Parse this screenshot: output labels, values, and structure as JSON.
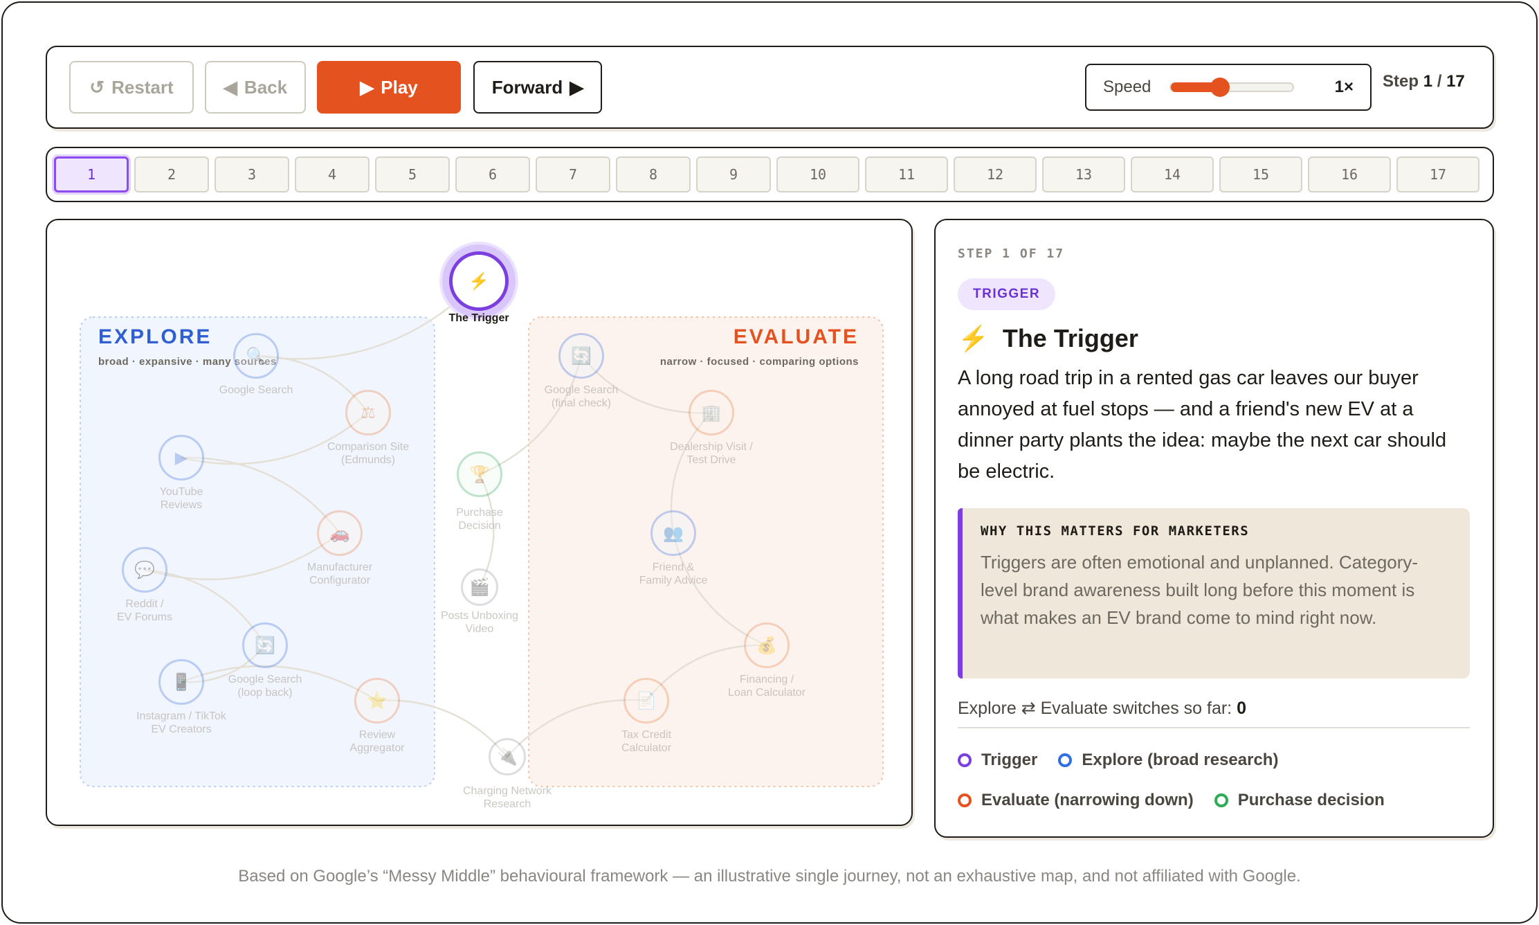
{
  "controls": {
    "restart_label": "Restart",
    "back_label": "Back",
    "play_label": "Play",
    "forward_label": "Forward",
    "speed_label": "Speed",
    "speed_value": "1×",
    "speed_level": 0.35,
    "step_prefix": "Step",
    "step_current": "1",
    "step_sep": "/",
    "step_total": "17",
    "colors": {
      "play": "#e4531f",
      "active": "#8b4cf0"
    }
  },
  "steps": [
    "1",
    "2",
    "3",
    "4",
    "5",
    "6",
    "7",
    "8",
    "9",
    "10",
    "11",
    "12",
    "13",
    "14",
    "15",
    "16",
    "17"
  ],
  "active_step": 1,
  "map": {
    "explore": {
      "title": "EXPLORE",
      "subtitle": "broad · expansive · many sources",
      "color": "#2f5fd0"
    },
    "evaluate": {
      "title": "EVALUATE",
      "subtitle": "narrow · focused · comparing options",
      "color": "#e4531f"
    },
    "nodes": [
      {
        "kind": "trigger",
        "icon": "⚡",
        "icon_name": "lightning-icon",
        "label": [
          "The Trigger"
        ]
      },
      {
        "kind": "explore",
        "icon": "🔍",
        "icon_name": "search-icon",
        "label": [
          "Google Search"
        ]
      },
      {
        "kind": "evaluate",
        "icon": "⚖",
        "icon_name": "scales-icon",
        "label": [
          "Comparison Site",
          "(Edmunds)"
        ]
      },
      {
        "kind": "explore",
        "icon": "▶",
        "icon_name": "play-video-icon",
        "label": [
          "YouTube",
          "Reviews"
        ]
      },
      {
        "kind": "evaluate",
        "icon": "🚗",
        "icon_name": "car-icon",
        "label": [
          "Manufacturer",
          "Configurator"
        ]
      },
      {
        "kind": "explore",
        "icon": "💬",
        "icon_name": "chat-bubble-icon",
        "label": [
          "Reddit /",
          "EV Forums"
        ]
      },
      {
        "kind": "explore",
        "icon": "🔄",
        "icon_name": "loop-search-icon",
        "label": [
          "Google Search",
          "(loop back)"
        ]
      },
      {
        "kind": "explore",
        "icon": "📱",
        "icon_name": "phone-icon",
        "label": [
          "Instagram / TikTok",
          "EV Creators"
        ]
      },
      {
        "kind": "evaluate",
        "icon": "⭐",
        "icon_name": "star-icon",
        "label": [
          "Review",
          "Aggregator"
        ]
      },
      {
        "kind": "neutral",
        "icon": "🔌",
        "icon_name": "plug-icon",
        "label": [
          "Charging Network",
          "Research"
        ]
      },
      {
        "kind": "evaluate",
        "icon": "📄",
        "icon_name": "document-icon",
        "label": [
          "Tax Credit",
          "Calculator"
        ]
      },
      {
        "kind": "evaluate",
        "icon": "💰",
        "icon_name": "money-bag-icon",
        "label": [
          "Financing /",
          "Loan Calculator"
        ]
      },
      {
        "kind": "explore",
        "icon": "👥",
        "icon_name": "people-icon",
        "label": [
          "Friend &",
          "Family Advice"
        ]
      },
      {
        "kind": "evaluate",
        "icon": "🏢",
        "icon_name": "dealership-icon",
        "label": [
          "Dealership Visit /",
          "Test Drive"
        ]
      },
      {
        "kind": "explore",
        "icon": "🔄",
        "icon_name": "final-check-search-icon",
        "label": [
          "Google Search",
          "(final check)"
        ]
      },
      {
        "kind": "purchase",
        "icon": "🏆",
        "icon_name": "trophy-icon",
        "label": [
          "Purchase",
          "Decision"
        ]
      },
      {
        "kind": "neutral",
        "icon": "🎬",
        "icon_name": "clapper-icon",
        "label": [
          "Posts Unboxing",
          "Video"
        ]
      }
    ]
  },
  "info": {
    "step_of": "STEP 1 OF 17",
    "badge": "TRIGGER",
    "title_icon": "⚡",
    "title": "The Trigger",
    "description": "A long road trip in a rented gas car leaves our buyer annoyed at fuel stops — and a friend's new EV at a dinner party plants the idea: maybe the next car should be electric.",
    "why_heading": "WHY THIS MATTERS FOR MARKETERS",
    "why_body": "Triggers are often emotional and unplanned. Category-level brand awareness built long before this moment is what makes an EV brand come to mind right now.",
    "switches_label": "Explore ⇄ Evaluate switches so far:",
    "switches_value": "0",
    "legend": [
      {
        "label": "Trigger",
        "color": "#7b3fe0"
      },
      {
        "label": "Explore (broad research)",
        "color": "#2f6fe0"
      },
      {
        "label": "Evaluate (narrowing down)",
        "color": "#e4531f"
      },
      {
        "label": "Purchase decision",
        "color": "#2faa55"
      }
    ]
  },
  "footer": "Based on Google’s “Messy Middle” behavioural framework — an illustrative single journey, not an exhaustive map, and not affiliated with Google."
}
